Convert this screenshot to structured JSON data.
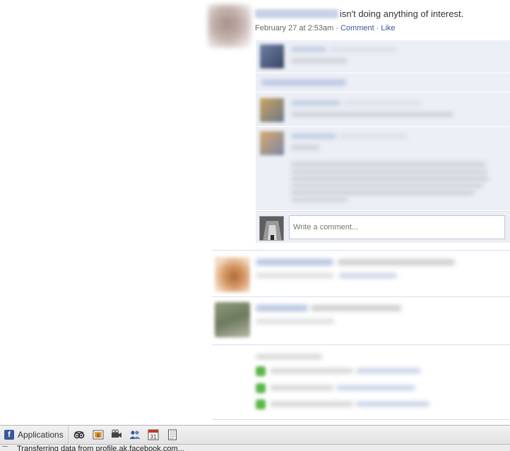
{
  "feed": {
    "status_story": {
      "status_text": "isn't doing anything of interest.",
      "timestamp": "February 27 at 2:53am",
      "separator": "·",
      "comment_link": "Comment",
      "like_link": "Like",
      "write_comment_placeholder": "Write a comment..."
    }
  },
  "appbar": {
    "applications_label": "Applications",
    "icons": [
      "tripadvisor-icon",
      "photos-icon",
      "video-icon",
      "friends-icon",
      "calendar-icon",
      "notes-icon"
    ],
    "calendar_day": "31"
  },
  "statusbar": {
    "text": "Transferring data from profile.ak.facebook.com..."
  },
  "colors": {
    "link": "#3b5998",
    "comment_bg": "#eceff5",
    "appbar_bg": "#e3e3e3"
  }
}
